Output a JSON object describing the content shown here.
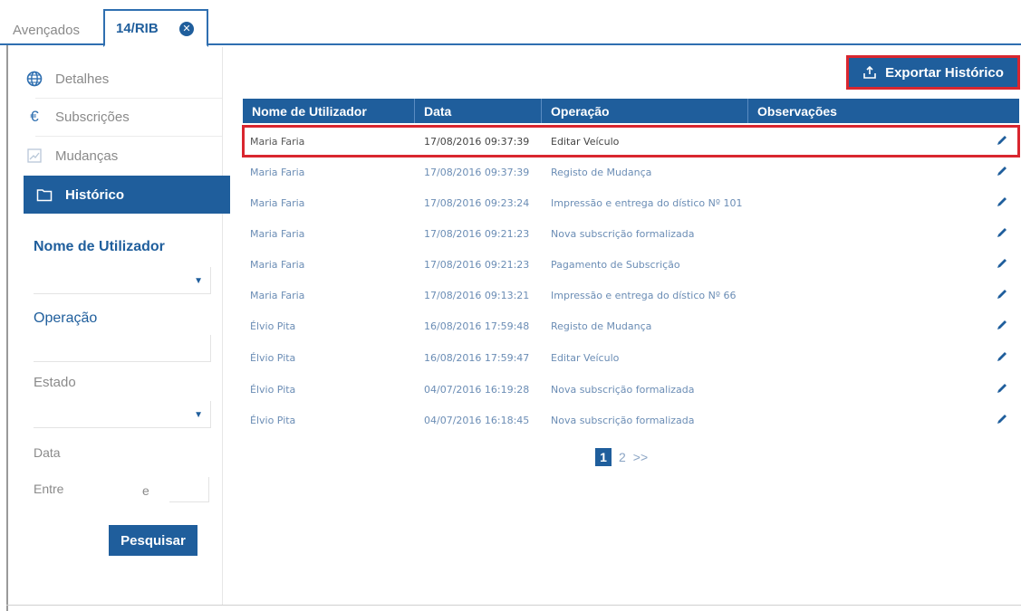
{
  "tabs": [
    {
      "label": "Avençados",
      "active": false
    },
    {
      "label": "14/RIB",
      "active": true
    }
  ],
  "sidebar": {
    "nav": [
      {
        "label": "Detalhes",
        "icon": "globe-icon"
      },
      {
        "label": "Subscrições",
        "icon": "euro-icon"
      },
      {
        "label": "Mudanças",
        "icon": "broken-image-icon"
      },
      {
        "label": "Histórico",
        "icon": "folder-icon",
        "active": true
      }
    ],
    "filters": {
      "user_label": "Nome de Utilizador",
      "operation_label": "Operação",
      "state_label": "Estado",
      "date_label": "Data",
      "between_label": "Entre",
      "and_label": "e"
    },
    "search_label": "Pesquisar"
  },
  "main": {
    "export_label": "Exportar Histórico",
    "columns": [
      "Nome de Utilizador",
      "Data",
      "Operação",
      "Observações"
    ],
    "rows": [
      {
        "user": "Maria Faria",
        "date": "17/08/2016 09:37:39",
        "operation": "Editar Veículo",
        "highlighted": true
      },
      {
        "user": "Maria Faria",
        "date": "17/08/2016 09:37:39",
        "operation": "Registo de Mudança"
      },
      {
        "user": "Maria Faria",
        "date": "17/08/2016 09:23:24",
        "operation": "Impressão e entrega do dístico Nº 101"
      },
      {
        "user": "Maria Faria",
        "date": "17/08/2016 09:21:23",
        "operation": "Nova subscrição formalizada"
      },
      {
        "user": "Maria Faria",
        "date": "17/08/2016 09:21:23",
        "operation": "Pagamento de Subscrição"
      },
      {
        "user": "Maria Faria",
        "date": "17/08/2016 09:13:21",
        "operation": "Impressão e entrega do dístico Nº 66"
      },
      {
        "user": "Élvio Pita",
        "date": "16/08/2016 17:59:48",
        "operation": "Registo de Mudança"
      },
      {
        "user": "Élvio Pita",
        "date": "16/08/2016 17:59:47",
        "operation": "Editar Veículo"
      },
      {
        "user": "Élvio Pita",
        "date": "04/07/2016 16:19:28",
        "operation": "Nova subscrição formalizada"
      },
      {
        "user": "Élvio Pita",
        "date": "04/07/2016 16:18:45",
        "operation": "Nova subscrição formalizada"
      }
    ],
    "pager": {
      "current": "1",
      "next_page": "2",
      "next_label": ">>"
    }
  },
  "colors": {
    "primary": "#1f5e9c",
    "highlight": "#d9262f",
    "muted_text": "#8a8a8a"
  }
}
